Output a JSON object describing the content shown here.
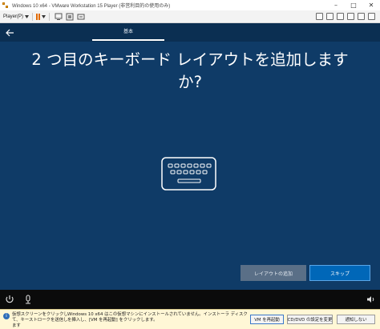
{
  "window": {
    "title": "Windows 10 x64 - VMware Workstation 15 Player (非営利目的の使用のみ)",
    "minimize": "–",
    "maximize": "□",
    "close": "✕"
  },
  "toolbar": {
    "player_label": "Player(P)",
    "icons": [
      "pause-icon",
      "vm-settings-icon",
      "send-ctrl-alt-del-icon",
      "fit-window-icon"
    ]
  },
  "setup": {
    "tab_label": "基本",
    "headline_line1": "2 つ目のキーボード レイアウトを追加します",
    "headline_line2": "か?",
    "add_layout_button": "レイアウトの追加",
    "skip_button": "スキップ"
  },
  "notification": {
    "left_text": "仮想スクリーンをクリックして、キーストロークを送信します",
    "message": "Windows 10 x64 はこの仮想マシンにインストールされていません。インストーラ ディスクを挿入し、[VM を再起動] をクリックします。",
    "restart_button": "VM を再起動",
    "cddvd_button": "CD/DVD の設定を変更",
    "close_button": "通知しない"
  },
  "colors": {
    "setup_background": "#0f3b67",
    "skip_button": "#0067b8",
    "pause_accent": "#e26a00"
  }
}
